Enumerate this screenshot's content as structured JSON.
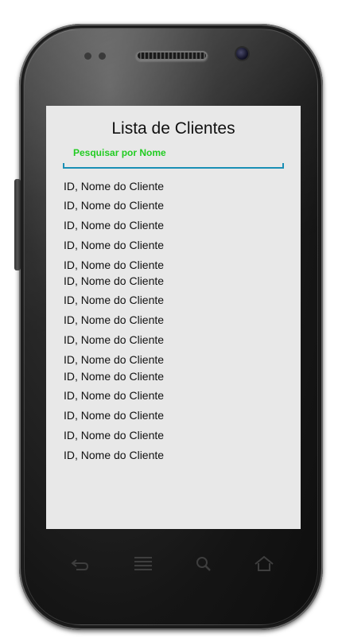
{
  "screen": {
    "title": "Lista de Clientes",
    "search_label": "Pesquisar por Nome"
  },
  "clients": [
    "ID, Nome do Cliente",
    "ID, Nome do Cliente",
    "ID, Nome do Cliente",
    "ID, Nome do Cliente",
    "ID, Nome do Cliente",
    "ID, Nome do Cliente",
    "ID, Nome do Cliente",
    "ID, Nome do Cliente",
    "ID, Nome do Cliente",
    "ID, Nome do Cliente",
    "ID, Nome do Cliente",
    "ID, Nome do Cliente",
    "ID, Nome do Cliente",
    "ID, Nome do Cliente",
    "ID, Nome do Cliente"
  ],
  "colors": {
    "search_label": "#22cc22",
    "search_underline": "#1a8fb5",
    "screen_background": "#e8e8e8"
  },
  "navbar": {
    "icons": [
      "back-icon",
      "menu-icon",
      "search-icon",
      "home-icon"
    ]
  }
}
